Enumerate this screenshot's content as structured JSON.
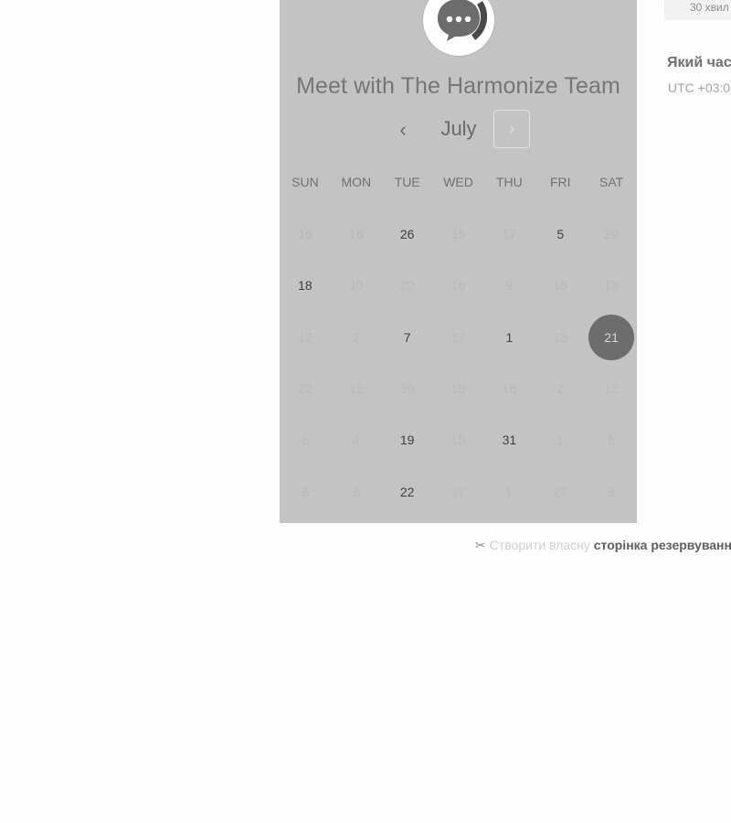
{
  "title": "Meet with The Harmonize Team",
  "calendar": {
    "month": "July",
    "prev_icon": "chevron-left-icon",
    "next_icon": "chevron-right-icon",
    "weekdays": [
      "SUN",
      "MON",
      "TUE",
      "WED",
      "THU",
      "FRI",
      "SAT"
    ],
    "weeks": [
      [
        {
          "d": "16",
          "a": false
        },
        {
          "d": "16",
          "a": false
        },
        {
          "d": "26",
          "a": true
        },
        {
          "d": "15",
          "a": false
        },
        {
          "d": "17",
          "a": false
        },
        {
          "d": "5",
          "a": true
        },
        {
          "d": "29",
          "a": false
        }
      ],
      [
        {
          "d": "18",
          "a": true
        },
        {
          "d": "10",
          "a": false
        },
        {
          "d": "22",
          "a": false
        },
        {
          "d": "16",
          "a": false
        },
        {
          "d": "9",
          "a": false
        },
        {
          "d": "15",
          "a": false
        },
        {
          "d": "13",
          "a": false
        }
      ],
      [
        {
          "d": "12",
          "a": false
        },
        {
          "d": "2",
          "a": false
        },
        {
          "d": "7",
          "a": true
        },
        {
          "d": "17",
          "a": false
        },
        {
          "d": "1",
          "a": true
        },
        {
          "d": "13",
          "a": false
        },
        {
          "d": "21",
          "a": true,
          "selected": true
        }
      ],
      [
        {
          "d": "22",
          "a": false
        },
        {
          "d": "12",
          "a": false
        },
        {
          "d": "30",
          "a": false
        },
        {
          "d": "18",
          "a": false
        },
        {
          "d": "16",
          "a": false
        },
        {
          "d": "2",
          "a": false
        },
        {
          "d": "12",
          "a": false
        }
      ],
      [
        {
          "d": "6",
          "a": false
        },
        {
          "d": "4",
          "a": false
        },
        {
          "d": "19",
          "a": true
        },
        {
          "d": "10",
          "a": false
        },
        {
          "d": "31",
          "a": true
        },
        {
          "d": "1",
          "a": false
        },
        {
          "d": "5",
          "a": false
        }
      ],
      [
        {
          "d": "6",
          "a": false
        },
        {
          "d": "6",
          "a": false
        },
        {
          "d": "22",
          "a": true
        },
        {
          "d": "17",
          "a": false
        },
        {
          "d": "1",
          "a": false
        },
        {
          "d": "27",
          "a": false
        },
        {
          "d": "8",
          "a": false
        }
      ]
    ]
  },
  "side": {
    "duration": "30 хвил",
    "time_question": "Який час",
    "timezone": "UTC +03:0"
  },
  "footer": {
    "plain": "Створити власну",
    "strong": "сторінка резервуванн"
  },
  "colors": {
    "panel_bg": "#c3c3c3",
    "selected_day": "#6d6d6d"
  }
}
